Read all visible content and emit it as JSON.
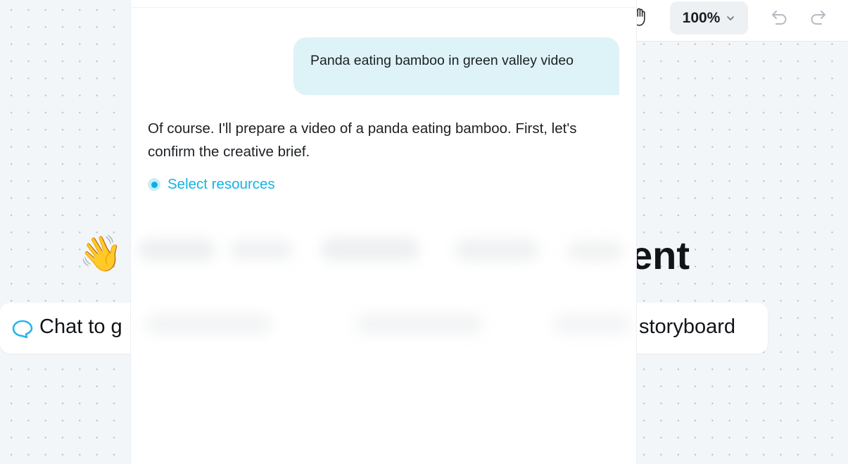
{
  "toolbar": {
    "hand_icon": "hand-icon",
    "zoom_value": "100%",
    "chevron_icon": "chevron-down-icon",
    "undo_icon": "undo-icon",
    "redo_icon": "redo-icon"
  },
  "hero": {
    "emoji": "👋",
    "title_visible": "ent"
  },
  "suggestions": {
    "chat_icon": "chat-bubble-icon",
    "left_label": "Chat to g",
    "right_label": "storyboard"
  },
  "chat": {
    "user_message": "Panda eating bamboo in green valley video",
    "assistant_message": "Of course. I'll prepare a video of a panda eating bamboo. First, let's confirm the creative brief.",
    "step_label": "Select resources",
    "accent_color": "#14b3e4"
  }
}
